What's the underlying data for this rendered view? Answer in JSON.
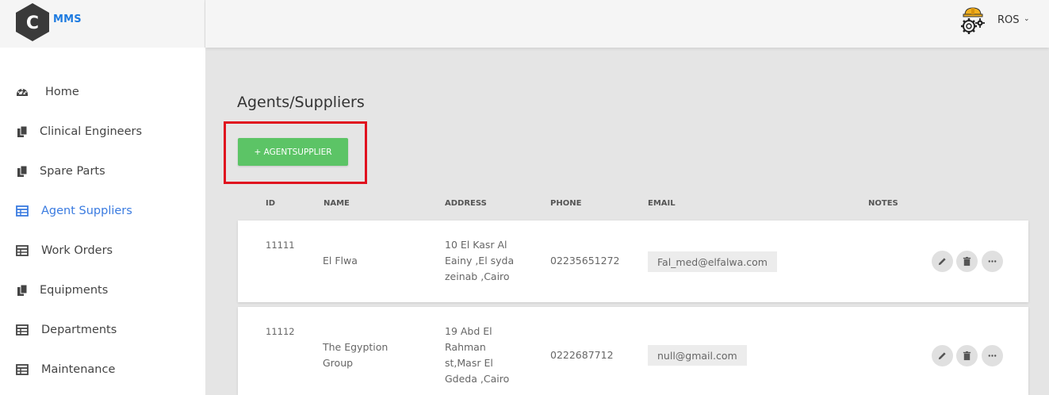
{
  "app": {
    "logo_letter": "C",
    "logo_text": "MMS"
  },
  "header": {
    "user_name": "ROS",
    "user_caret": "⌄",
    "user_icon": "engineer-gear-icon"
  },
  "sidebar": {
    "items": [
      {
        "label": "Home",
        "icon": "dashboard-icon",
        "active": false
      },
      {
        "label": "Clinical Engineers",
        "icon": "copy-icon",
        "active": false
      },
      {
        "label": "Spare Parts",
        "icon": "copy-icon",
        "active": false
      },
      {
        "label": "Agent Suppliers",
        "icon": "table-icon",
        "active": true
      },
      {
        "label": "Work Orders",
        "icon": "table-icon",
        "active": false
      },
      {
        "label": "Equipments",
        "icon": "copy-icon",
        "active": false
      },
      {
        "label": "Departments",
        "icon": "table-icon",
        "active": false
      },
      {
        "label": "Maintenance",
        "icon": "table-icon",
        "active": false
      }
    ]
  },
  "main": {
    "title": "Agents/Suppliers",
    "add_button": "+ AGENTSUPPLIER",
    "columns": {
      "id": "ID",
      "name": "NAME",
      "address": "ADDRESS",
      "phone": "PHONE",
      "email": "EMAIL",
      "notes": "NOTES"
    },
    "rows": [
      {
        "id": "11111",
        "name": "El Flwa",
        "address": [
          "10 El Kasr Al",
          "Eainy ,El syda",
          "zeinab ,Cairo"
        ],
        "phone": "02235651272",
        "email": "Fal_med@elfalwa.com",
        "notes": ""
      },
      {
        "id": "11112",
        "name": [
          "The Egyption",
          "Group"
        ],
        "address": [
          "19 Abd El",
          "Rahman",
          "st,Masr El",
          "Gdeda ,Cairo"
        ],
        "phone": "0222687712",
        "email": "null@gmail.com",
        "notes": ""
      }
    ]
  },
  "colors": {
    "accent": "#3a7be0",
    "success": "#5cc466",
    "highlight": "#e0101e",
    "background": "#e5e5e5"
  }
}
